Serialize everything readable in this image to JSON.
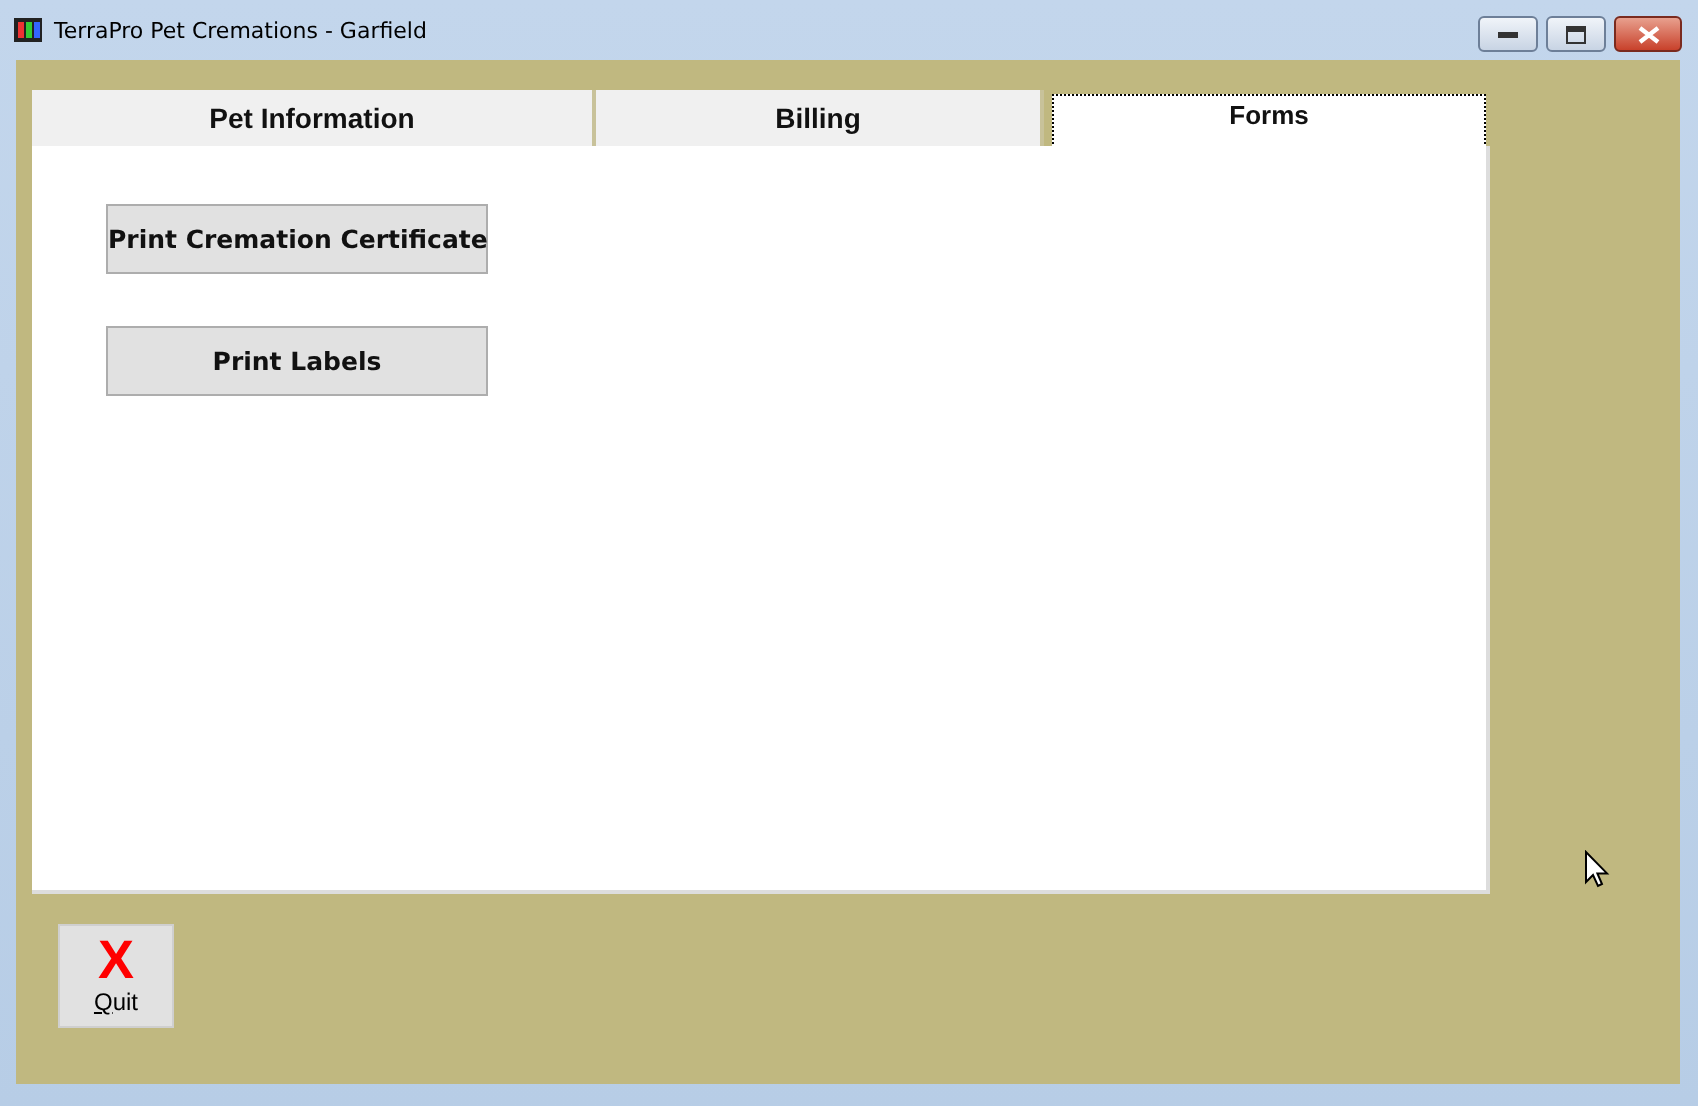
{
  "window": {
    "title": "TerraPro Pet Cremations - Garfield"
  },
  "tabs": [
    {
      "label": "Pet Information",
      "selected": false
    },
    {
      "label": "Billing",
      "selected": false
    },
    {
      "label": "Forms",
      "selected": true
    }
  ],
  "buttons": [
    "Print Cremation Certificate",
    "Print Labels"
  ],
  "quit": {
    "label": "Quit",
    "icon": "X"
  }
}
